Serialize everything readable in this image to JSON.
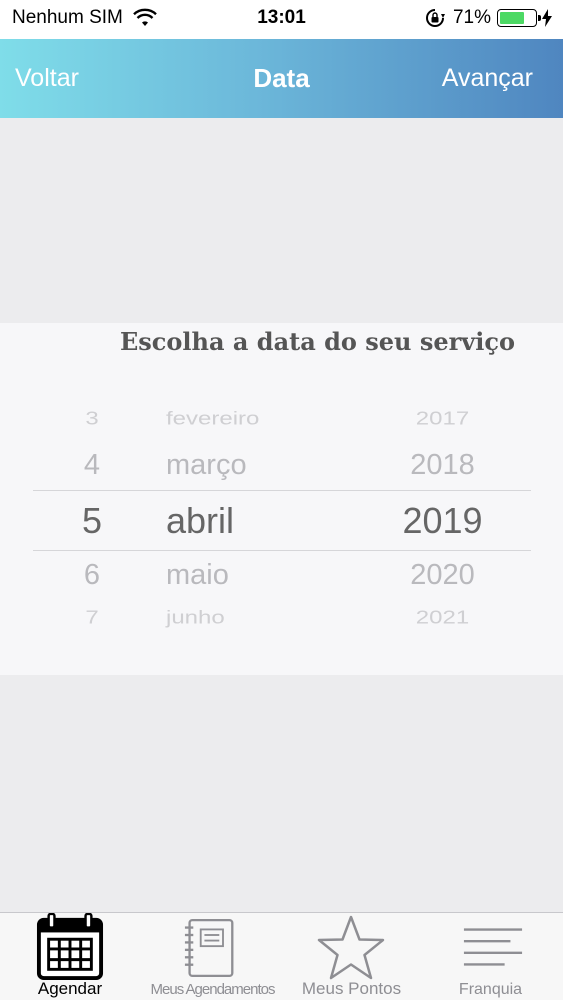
{
  "status_bar": {
    "carrier": "Nenhum SIM",
    "time": "13:01",
    "battery": "71%",
    "battery_level": 0.71,
    "battery_color": "#4cd964",
    "icons": [
      "wifi-icon",
      "orientation-lock-icon",
      "battery-icon",
      "charging-bolt-icon"
    ]
  },
  "nav": {
    "back_label": "Voltar",
    "title": "Data",
    "next_label": "Avançar",
    "gradient": [
      "#7fdde9",
      "#4f86c0"
    ]
  },
  "panel": {
    "title": "Escolha a data do seu serviço"
  },
  "picker": {
    "days": [
      "3",
      "4",
      "5",
      "6",
      "7"
    ],
    "months": [
      "fevereiro",
      "março",
      "abril",
      "maio",
      "junho"
    ],
    "years": [
      "2017",
      "2018",
      "2019",
      "2020",
      "2021"
    ],
    "selected": {
      "day": "5",
      "month": "abril",
      "year": "2019"
    }
  },
  "tab_bar": {
    "tabs": [
      {
        "label": "Agendar",
        "icon": "calendar-icon",
        "active": true
      },
      {
        "label": "Meus Agendamentos",
        "icon": "notebook-icon",
        "active": false
      },
      {
        "label": "Meus Pontos",
        "icon": "star-icon",
        "active": false
      },
      {
        "label": "Franquia",
        "icon": "menu-lines-icon",
        "active": false
      }
    ]
  }
}
